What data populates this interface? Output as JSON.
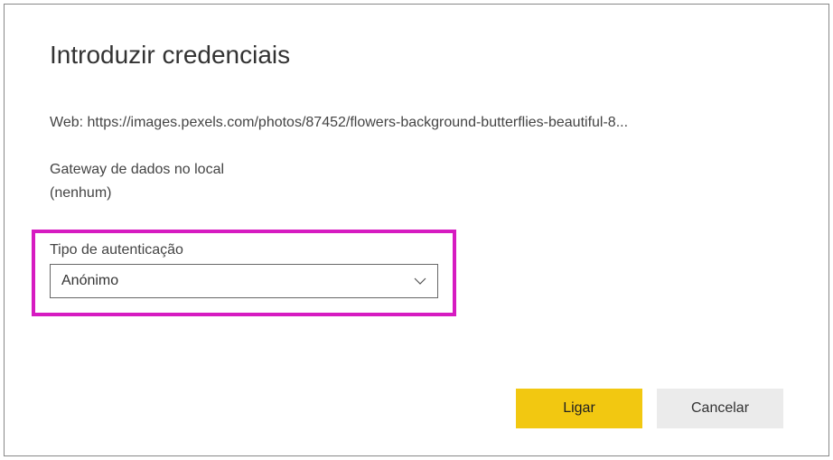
{
  "dialog": {
    "title": "Introduzir credenciais",
    "source_prefix": "Web: ",
    "source_url": "https://images.pexels.com/photos/87452/flowers-background-butterflies-beautiful-8...",
    "gateway": {
      "label": "Gateway de dados no local",
      "value": "(nenhum)"
    },
    "auth": {
      "label": "Tipo de autenticação",
      "selected": "Anónimo"
    },
    "buttons": {
      "connect": "Ligar",
      "cancel": "Cancelar"
    }
  }
}
